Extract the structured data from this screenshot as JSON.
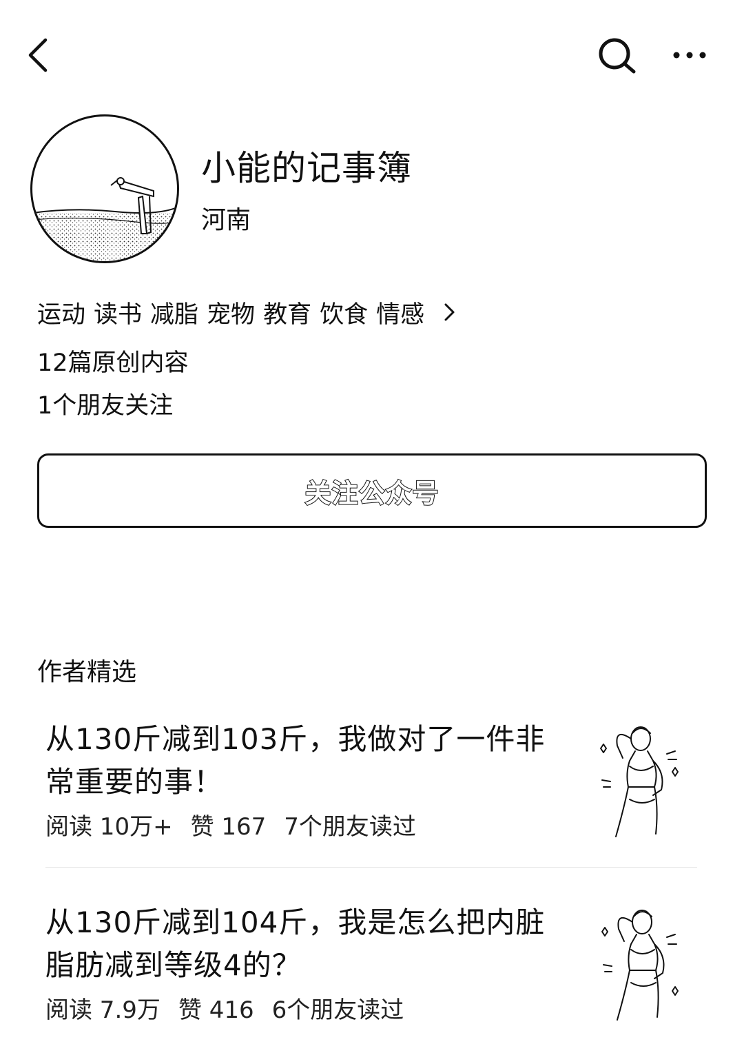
{
  "account": {
    "name": "小能的记事簿",
    "location": "河南",
    "tags": [
      "运动",
      "读书",
      "减脂",
      "宠物",
      "教育",
      "饮食",
      "情感"
    ],
    "original_count": "12篇原创内容",
    "friends_following": "1个朋友关注"
  },
  "actions": {
    "follow_label": "关注公众号"
  },
  "section": {
    "title": "作者精选"
  },
  "articles": [
    {
      "title": "从130斤减到103斤，我做对了一件非常重要的事！",
      "reads": "阅读 10万+",
      "likes": "赞 167",
      "friends_read": "7个朋友读过"
    },
    {
      "title": "从130斤减到104斤，我是怎么把内脏脂肪减到等级4的？",
      "reads": "阅读 7.9万",
      "likes": "赞 416",
      "friends_read": "6个朋友读过"
    }
  ],
  "icons": {
    "back": "chevron-left-icon",
    "search": "search-icon",
    "more": "more-dots-icon",
    "tags_more": "chevron-right-icon"
  }
}
